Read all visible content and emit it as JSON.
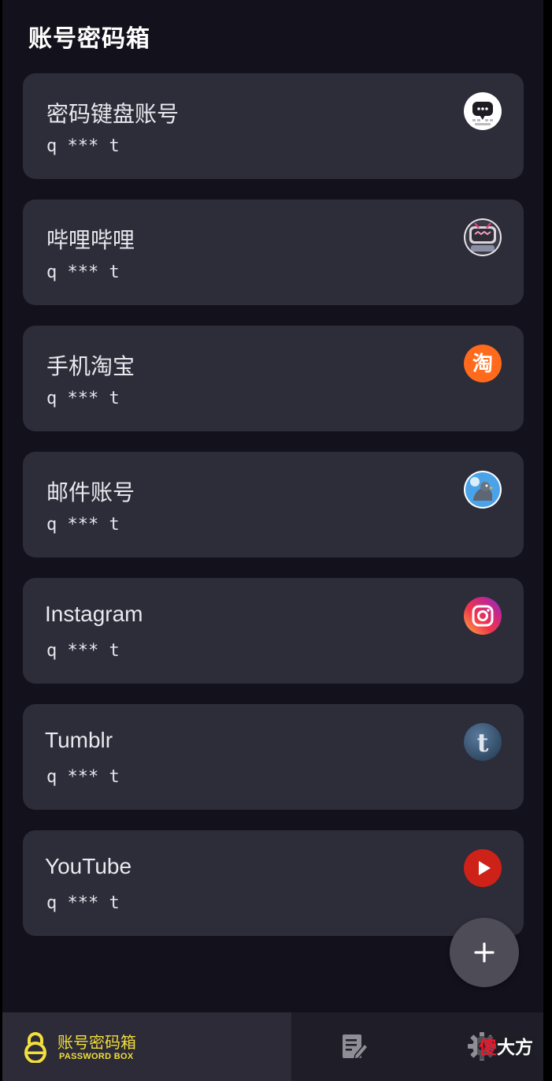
{
  "header": {
    "title": "账号密码箱"
  },
  "entries": [
    {
      "name": "密码键盘账号",
      "account": "q *** t",
      "icon": "keyboard-app-icon"
    },
    {
      "name": "哔哩哔哩",
      "account": "q *** t",
      "icon": "bilibili-icon"
    },
    {
      "name": "手机淘宝",
      "account": "q *** t",
      "icon": "taobao-icon"
    },
    {
      "name": "邮件账号",
      "account": "q *** t",
      "icon": "mail-app-icon"
    },
    {
      "name": "Instagram",
      "account": "q *** t",
      "icon": "instagram-icon"
    },
    {
      "name": "Tumblr",
      "account": "q *** t",
      "icon": "tumblr-icon"
    },
    {
      "name": "YouTube",
      "account": "q *** t",
      "icon": "youtube-icon"
    }
  ],
  "fab": {
    "icon": "plus-icon"
  },
  "navbar": {
    "active_label": "账号密码箱",
    "active_sublabel": "PASSWORD BOX",
    "tabs": [
      {
        "icon": "lock-icon",
        "active": true
      },
      {
        "icon": "notes-edit-icon",
        "active": false
      },
      {
        "icon": "gear-icon",
        "active": false
      }
    ]
  },
  "watermark": {
    "red_char": "傻",
    "rest": "大方"
  },
  "colors": {
    "background": "#13121c",
    "card": "#2d2c39",
    "accent_yellow": "#f2de3c",
    "fab": "#4d4c57",
    "navbar": "#1e1d28",
    "navbar_active": "#2c2b37"
  }
}
